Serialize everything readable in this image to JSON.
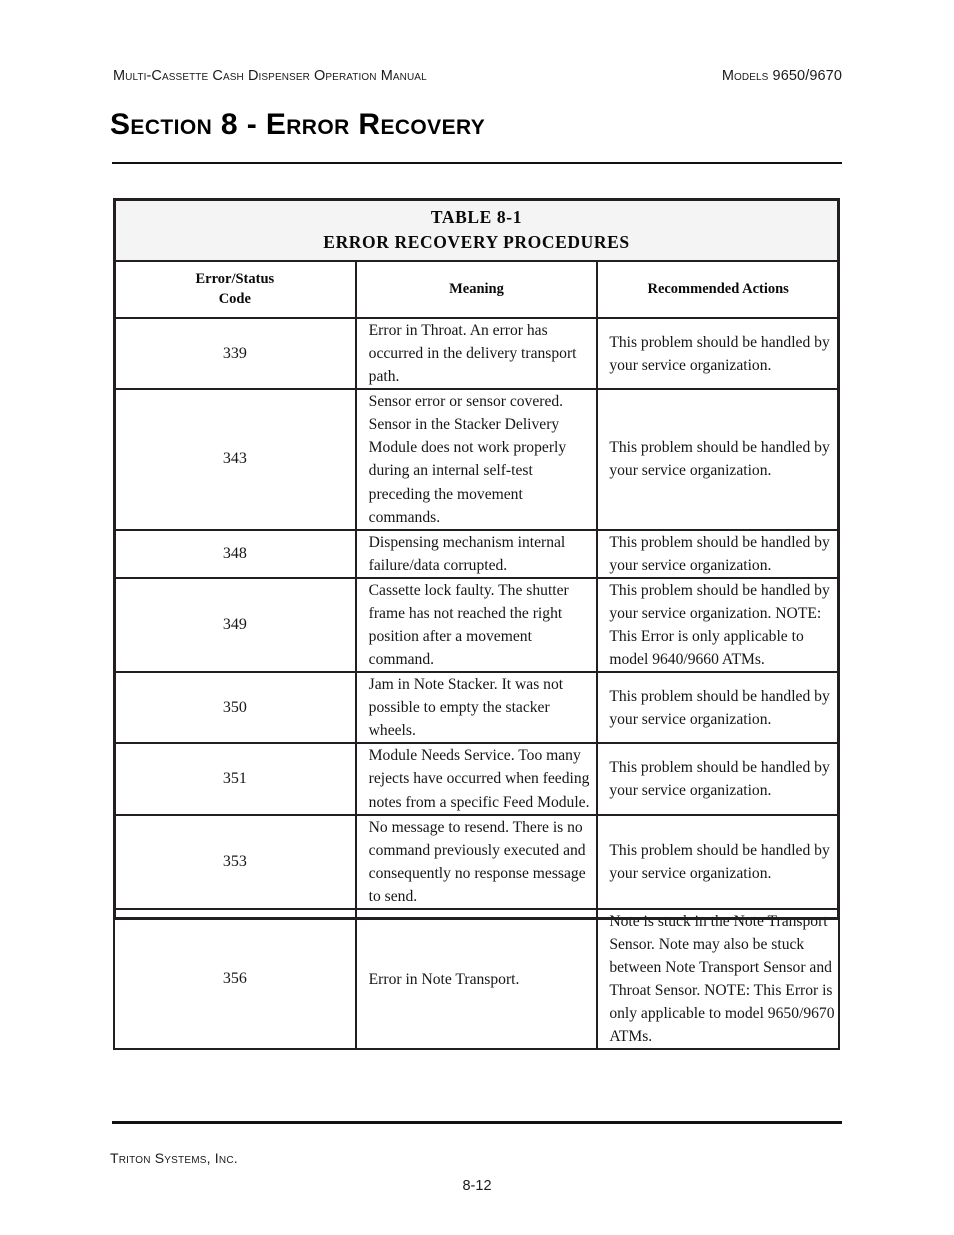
{
  "header": {
    "left_text": "Multi-Cassette Cash Dispenser Operation Manual",
    "right_text": "Models 9650/9670"
  },
  "section": {
    "title": "Section 8 - Error Recovery"
  },
  "table": {
    "title_line1": "TABLE 8-1",
    "title_line2": "ERROR RECOVERY PROCEDURES",
    "columns": [
      "Error/Status Code",
      "Meaning",
      "Recommended Actions"
    ],
    "column_header_lines": [
      [
        "Error/Status",
        "Code"
      ],
      [
        "Meaning"
      ],
      [
        "Recommended Actions"
      ]
    ],
    "rows": [
      {
        "code": "339",
        "meaning": "Error in Throat. An error has occurred in the delivery transport path.",
        "actions": "This problem should be handled by your service organization."
      },
      {
        "code": "343",
        "meaning": "Sensor error or sensor covered. Sensor in the Stacker Delivery Module does not work properly during an internal self-test preceding the movement commands.",
        "actions": "This problem should be handled by your service organization."
      },
      {
        "code": "348",
        "meaning": "Dispensing mechanism internal failure/data corrupted.",
        "actions": "This problem should be handled by your service organization."
      },
      {
        "code": "349",
        "meaning": "Cassette lock faulty. The shutter frame has not reached the right position after a movement command.",
        "actions": "This problem should be handled by your service organization. NOTE: This Error is only applicable to model 9640/9660 ATMs."
      },
      {
        "code": "350",
        "meaning": "Jam in Note Stacker. It was not possible to empty the stacker wheels.",
        "actions": "This problem should be handled by your service organization."
      },
      {
        "code": "351",
        "meaning": "Module Needs Service. Too many rejects have occurred when feeding notes from a specific Feed Module.",
        "actions": "This problem should be handled by your service organization."
      },
      {
        "code": "353",
        "meaning": "No message to resend. There is no command previously executed and consequently no response message to send.",
        "actions": "This problem should be handled by your service organization."
      },
      {
        "code": "356",
        "meaning": "Error in Note Transport.",
        "actions": "Note is stuck in the Note Transport Sensor. Note may also be stuck between Note Transport Sensor and Throat Sensor. NOTE: This Error is only applicable to model 9650/9670 ATMs."
      }
    ]
  },
  "footer": {
    "company": "Triton Systems, Inc.",
    "page_number": "8-12"
  },
  "colors": {
    "text": "#161616",
    "rule": "#111111",
    "table_border": "#231f20",
    "title_fill": "#f4f4f4"
  }
}
